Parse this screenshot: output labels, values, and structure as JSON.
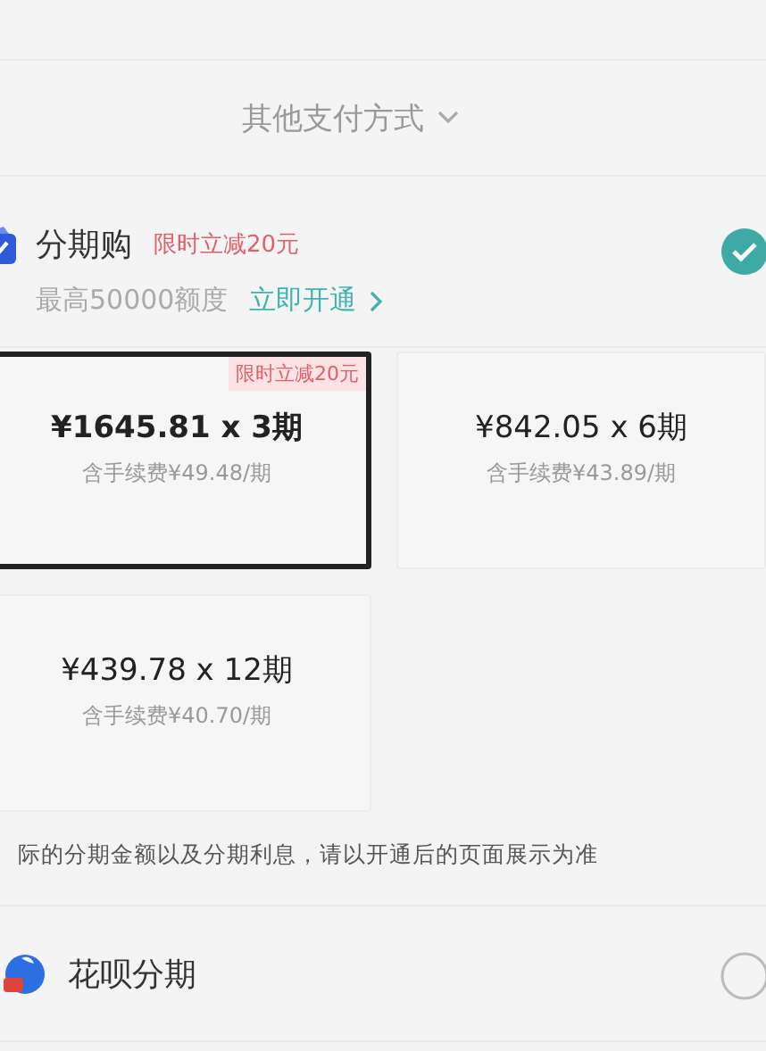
{
  "other_payment": {
    "label": "其他支付方式"
  },
  "methods": [
    {
      "kind": "installment",
      "name": "分期购",
      "promo": "限时立减20元",
      "subtitle": "最高50000额度",
      "link": "立即开通",
      "selected": true,
      "plans": [
        {
          "amount": "¥1645.81 x 3期",
          "fee": "含手续费¥49.48/期",
          "badge": "限时立减20元",
          "selected": true
        },
        {
          "amount": "¥842.05 x 6期",
          "fee": "含手续费¥43.89/期",
          "selected": false
        },
        {
          "amount": "¥439.78 x 12期",
          "fee": "含手续费¥40.70/期",
          "selected": false
        }
      ],
      "note": "际的分期金额以及分期利息，请以开通后的页面展示为准"
    },
    {
      "kind": "huabei",
      "name": "花呗分期",
      "selected": false
    }
  ]
}
